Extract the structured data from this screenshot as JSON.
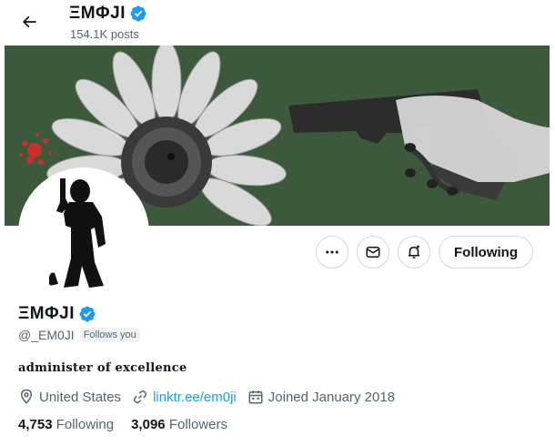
{
  "header": {
    "name": "ΞMΦJI",
    "posts": "154.1K posts"
  },
  "profile": {
    "name": "ΞMΦJI",
    "handle": "@_EM0JI",
    "follows_you": "Follows you",
    "bio": "administer of excellence",
    "location": "United States",
    "link": "linktr.ee/em0ji",
    "joined": "Joined January 2018",
    "following_count": "4,753",
    "following_label": "Following",
    "followers_count": "3,096",
    "followers_label": "Followers"
  },
  "actions": {
    "following_button": "Following"
  },
  "icons": [
    "back-arrow-icon",
    "verified-badge-icon",
    "more-icon",
    "message-icon",
    "notification-bell-icon",
    "location-icon",
    "link-icon",
    "calendar-icon"
  ],
  "colors": {
    "accent": "#1d9bf0",
    "banner_bg": "#3c5a3b",
    "text_secondary": "#536471"
  }
}
